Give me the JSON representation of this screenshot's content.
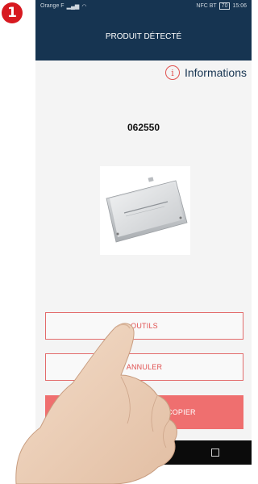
{
  "step_number": "1",
  "status_bar": {
    "carrier": "Orange F",
    "right_icons": "NFC BT",
    "battery": "70",
    "time": "15:06"
  },
  "header": {
    "title": "PRODUIT DÉTECTÉ"
  },
  "info": {
    "icon": "info-icon",
    "label": "Informations"
  },
  "product": {
    "code": "062550"
  },
  "buttons": {
    "tools": "OUTILS",
    "cancel": "ANNULER",
    "params_copy": "LES PARAMÈTRES / COPIER"
  },
  "colors": {
    "header_bg": "#163451",
    "accent_red": "#e0514f",
    "button_fill": "#ef6f6f",
    "badge": "#d71920"
  }
}
